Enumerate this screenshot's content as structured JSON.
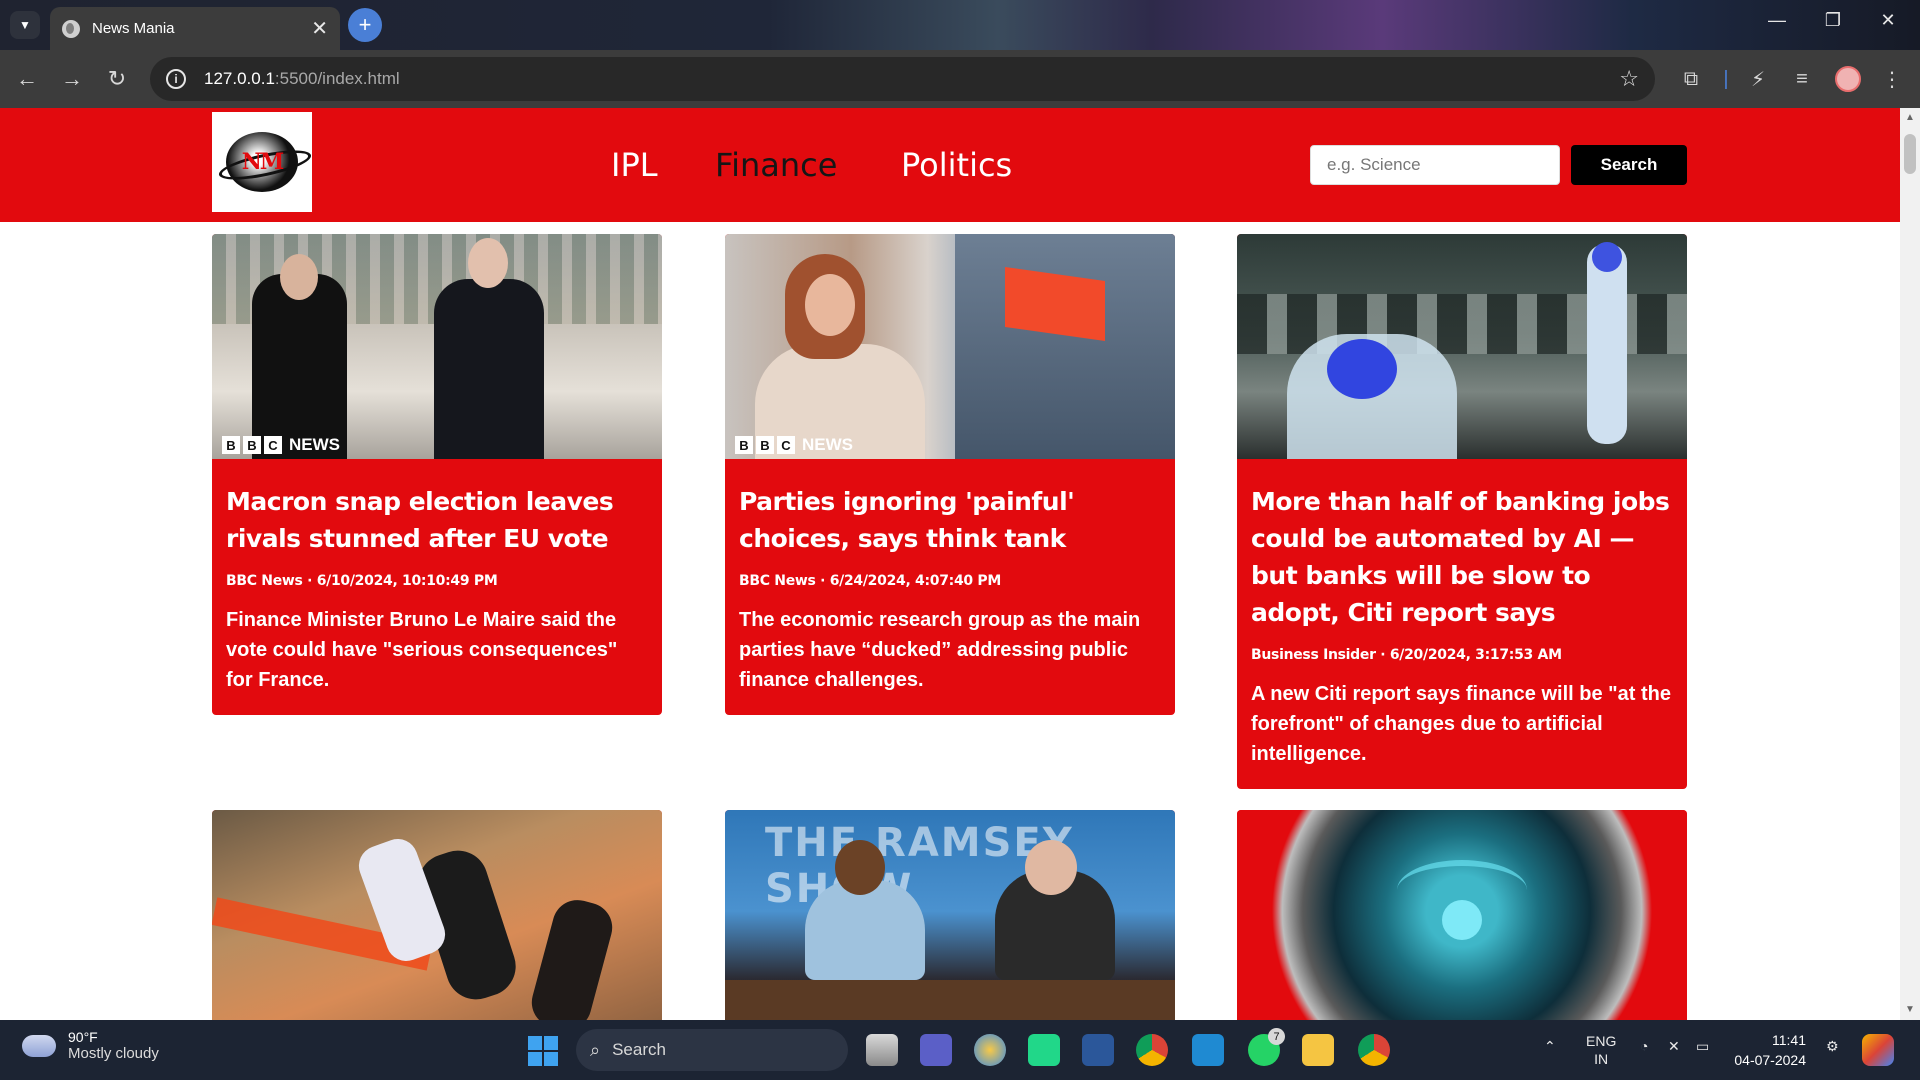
{
  "browser": {
    "tab_title": "News Mania",
    "tab_close": "✕",
    "new_tab": "+",
    "url_host": "127.0.0.1",
    "url_path": ":5500/index.html"
  },
  "site": {
    "logo_text": "NM",
    "nav": [
      {
        "label": "IPL"
      },
      {
        "label": "Finance"
      },
      {
        "label": "Politics"
      }
    ],
    "search_placeholder": "e.g. Science",
    "search_button": "Search"
  },
  "articles": [
    {
      "title": "Macron snap election leaves rivals stunned after EU vote",
      "meta": "BBC News · 6/10/2024, 10:10:49 PM",
      "description": "Finance Minister Bruno Le Maire said the vote could have \"serious consequences\" for France.",
      "image_watermark": "NEWS"
    },
    {
      "title": "Parties ignoring 'painful' choices, says think tank",
      "meta": "BBC News · 6/24/2024, 4:07:40 PM",
      "description": "The economic research group as the main parties have “ducked” addressing public finance challenges.",
      "image_watermark": "NEWS"
    },
    {
      "title": "More than half of banking jobs could be automated by AI — but banks will be slow to adopt, Citi report says",
      "meta": "Business Insider · 6/20/2024, 3:17:53 AM",
      "description": "A new Citi report says finance will be \"at the forefront\" of changes due to artificial intelligence.",
      "image_watermark": ""
    },
    {
      "title": "",
      "meta": "",
      "description": "",
      "image_watermark": ""
    },
    {
      "title": "",
      "meta": "",
      "description": "",
      "image_watermark": "THE RAMSEY SHOW"
    },
    {
      "title": "",
      "meta": "",
      "description": "",
      "image_watermark": ""
    }
  ],
  "taskbar": {
    "temperature": "90°F",
    "weather": "Mostly cloudy",
    "search_label": "Search",
    "teams_badge": "7",
    "whatsapp_badge": "7",
    "lang_1": "ENG",
    "lang_2": "IN",
    "time": "11:41",
    "date": "04-07-2024"
  },
  "colors": {
    "brand_red": "#e20a0e",
    "chrome_dark": "#3c3c3c",
    "taskbar": "#1c2433"
  }
}
